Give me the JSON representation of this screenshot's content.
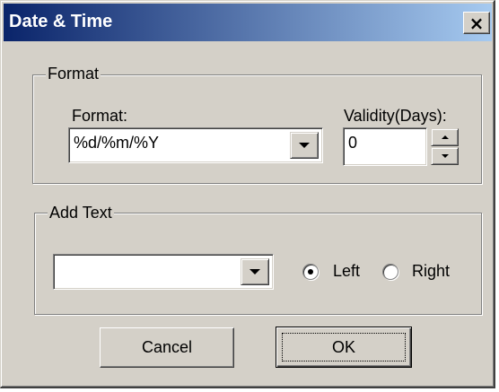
{
  "window": {
    "title": "Date & Time",
    "close_glyph": "×"
  },
  "format_group": {
    "legend": "Format",
    "format_label": "Format:",
    "format_value": "%d/%m/%Y",
    "validity_label": "Validity(Days):",
    "validity_value": "0"
  },
  "add_text_group": {
    "legend": "Add Text",
    "text_value": "",
    "radio_left_label": "Left",
    "radio_right_label": "Right",
    "selected_alignment": "Left"
  },
  "buttons": {
    "cancel_label": "Cancel",
    "ok_label": "OK"
  },
  "icons": {
    "close": "close-icon",
    "dropdown": "chevron-down-icon",
    "spin_up": "spin-up-icon",
    "spin_down": "spin-down-icon"
  },
  "colors": {
    "face": "#d4d0c8",
    "title_start": "#0a246a",
    "title_end": "#a6caf0"
  }
}
